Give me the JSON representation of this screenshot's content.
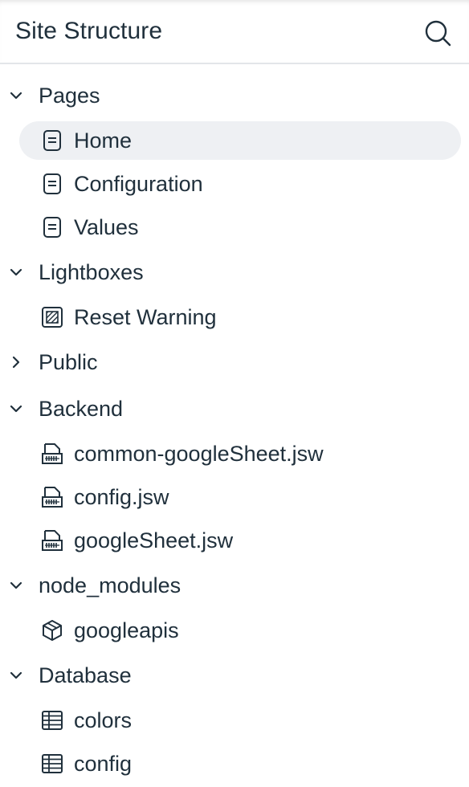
{
  "header": {
    "title": "Site Structure",
    "search_icon": "search-icon"
  },
  "tree": {
    "pages": {
      "label": "Pages",
      "expanded": true,
      "items": [
        {
          "label": "Home",
          "icon": "page-icon",
          "selected": true
        },
        {
          "label": "Configuration",
          "icon": "page-icon"
        },
        {
          "label": "Values",
          "icon": "page-icon"
        }
      ]
    },
    "lightboxes": {
      "label": "Lightboxes",
      "expanded": true,
      "items": [
        {
          "label": "Reset Warning",
          "icon": "lightbox-icon"
        }
      ]
    },
    "public": {
      "label": "Public",
      "expanded": false
    },
    "backend": {
      "label": "Backend",
      "expanded": true,
      "items": [
        {
          "label": "common-googleSheet.jsw",
          "icon": "web-module-icon"
        },
        {
          "label": "config.jsw",
          "icon": "web-module-icon"
        },
        {
          "label": "googleSheet.jsw",
          "icon": "web-module-icon"
        }
      ]
    },
    "node_modules": {
      "label": "node_modules",
      "expanded": true,
      "items": [
        {
          "label": "googleapis",
          "icon": "package-icon"
        }
      ]
    },
    "database": {
      "label": "Database",
      "expanded": true,
      "items": [
        {
          "label": "colors",
          "icon": "collection-icon"
        },
        {
          "label": "config",
          "icon": "collection-icon"
        }
      ]
    }
  },
  "colors": {
    "text": "#20303c",
    "selected_bg": "#eef0f3",
    "divider": "#e3e6e9"
  }
}
